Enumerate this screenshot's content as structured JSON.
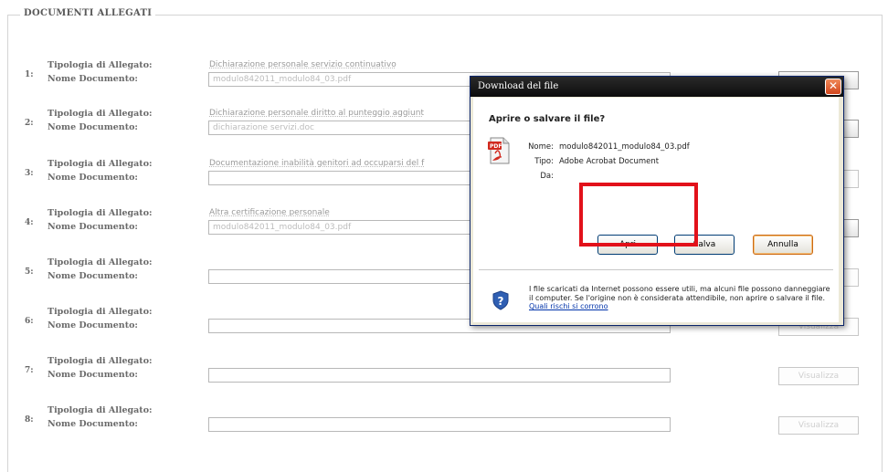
{
  "section": {
    "title": "DOCUMENTI ALLEGATI",
    "type_label": "Tipologia di Allegato:",
    "name_label": "Nome Documento:",
    "view_label": "Visualizza"
  },
  "rows": [
    {
      "num": "1:",
      "tipologia": "Dichiarazione personale servizio continuativo",
      "documento": "modulo842011_modulo84_03.pdf"
    },
    {
      "num": "2:",
      "tipologia": "Dichiarazione personale diritto al punteggio aggiunt",
      "documento": "dichiarazione servizi.doc"
    },
    {
      "num": "3:",
      "tipologia": "Documentazione inabilità genitori ad occuparsi del f",
      "documento": ""
    },
    {
      "num": "4:",
      "tipologia": "Altra certificazione personale",
      "documento": "modulo842011_modulo84_03.pdf"
    },
    {
      "num": "5:",
      "tipologia": "",
      "documento": ""
    },
    {
      "num": "6:",
      "tipologia": "",
      "documento": ""
    },
    {
      "num": "7:",
      "tipologia": "",
      "documento": ""
    },
    {
      "num": "8:",
      "tipologia": "",
      "documento": ""
    }
  ],
  "dialog": {
    "title": "Download del file",
    "question": "Aprire o salvare il file?",
    "name_key": "Nome:",
    "name_value": "modulo842011_modulo84_03.pdf",
    "type_key": "Tipo:",
    "type_value": "Adobe Acrobat Document",
    "from_key": "Da:",
    "open_label": "Apri",
    "save_label": "Salva",
    "cancel_label": "Annulla",
    "warning": "I file scaricati da Internet possono essere utili, ma alcuni file possono danneggiare il computer. Se l'origine non è considerata attendibile, non aprire o salvare il file.",
    "warning_link": "Quali rischi si corrono"
  },
  "colors": {
    "highlight": "#e2111a",
    "dialog_title_bar": "#111111",
    "link": "#0033aa"
  }
}
